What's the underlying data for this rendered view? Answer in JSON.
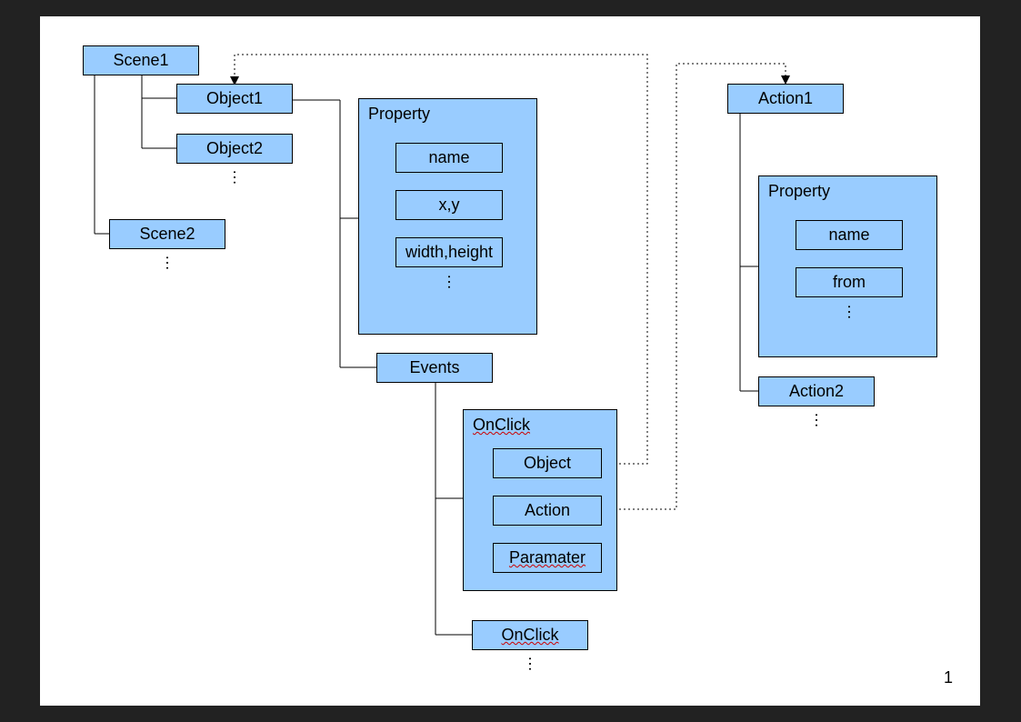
{
  "page_number": "1",
  "scenes": {
    "scene1": "Scene1",
    "scene2": "Scene2",
    "objects": {
      "object1": "Object1",
      "object2": "Object2"
    }
  },
  "object_detail": {
    "property_title": "Property",
    "properties": {
      "name": "name",
      "xy": "x,y",
      "wh": "width,height"
    },
    "events_label": "Events",
    "event_block": {
      "title": "OnClick",
      "object": "Object",
      "action": "Action",
      "parameter": "Paramater"
    },
    "event2": "OnClick"
  },
  "actions": {
    "action1": "Action1",
    "action2": "Action2",
    "property_title": "Property",
    "properties": {
      "name": "name",
      "from": "from"
    }
  }
}
